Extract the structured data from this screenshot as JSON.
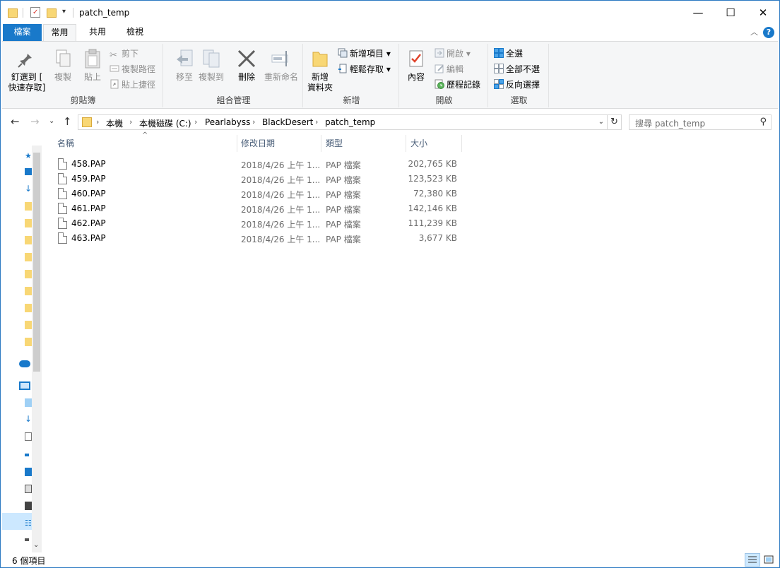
{
  "window": {
    "title": "patch_temp",
    "minimize_glyph": "—",
    "maximize_glyph": "☐",
    "close_glyph": "✕"
  },
  "ribbon_tabs": {
    "file": "檔案",
    "home": "常用",
    "share": "共用",
    "view": "檢視"
  },
  "ribbon": {
    "clipboard": {
      "label": "剪貼簿",
      "pin_line1": "釘選到 [",
      "pin_line2": "快速存取]",
      "copy": "複製",
      "paste": "貼上",
      "cut": "剪下",
      "copy_path": "複製路徑",
      "paste_shortcut": "貼上捷徑"
    },
    "organize": {
      "label": "組合管理",
      "move_to": "移至",
      "copy_to": "複製到",
      "delete": "刪除",
      "rename": "重新命名"
    },
    "new": {
      "label": "新增",
      "new_folder_line1": "新增",
      "new_folder_line2": "資料夾",
      "new_item": "新增項目",
      "easy_access": "輕鬆存取"
    },
    "open": {
      "label": "開啟",
      "properties": "內容",
      "open": "開啟",
      "edit": "編輯",
      "history": "歷程記錄"
    },
    "select": {
      "label": "選取",
      "select_all": "全選",
      "select_none": "全部不選",
      "invert": "反向選擇"
    }
  },
  "address": {
    "crumbs": [
      "本機",
      "本機磁碟 (C:)",
      "Pearlabyss",
      "BlackDesert",
      "patch_temp"
    ],
    "search_placeholder": "搜尋 patch_temp"
  },
  "columns": {
    "name": "名稱",
    "date": "修改日期",
    "type": "類型",
    "size": "大小"
  },
  "files": [
    {
      "name": "458.PAP",
      "date": "2018/4/26 上午 1...",
      "type": "PAP 檔案",
      "size": "202,765 KB"
    },
    {
      "name": "459.PAP",
      "date": "2018/4/26 上午 1...",
      "type": "PAP 檔案",
      "size": "123,523 KB"
    },
    {
      "name": "460.PAP",
      "date": "2018/4/26 上午 1...",
      "type": "PAP 檔案",
      "size": "72,380 KB"
    },
    {
      "name": "461.PAP",
      "date": "2018/4/26 上午 1...",
      "type": "PAP 檔案",
      "size": "142,146 KB"
    },
    {
      "name": "462.PAP",
      "date": "2018/4/26 上午 1...",
      "type": "PAP 檔案",
      "size": "111,239 KB"
    },
    {
      "name": "463.PAP",
      "date": "2018/4/26 上午 1...",
      "type": "PAP 檔案",
      "size": "3,677 KB"
    }
  ],
  "status": {
    "item_count": "6 個項目"
  },
  "colors": {
    "accent": "#1979ca",
    "folder": "#f8d775"
  }
}
